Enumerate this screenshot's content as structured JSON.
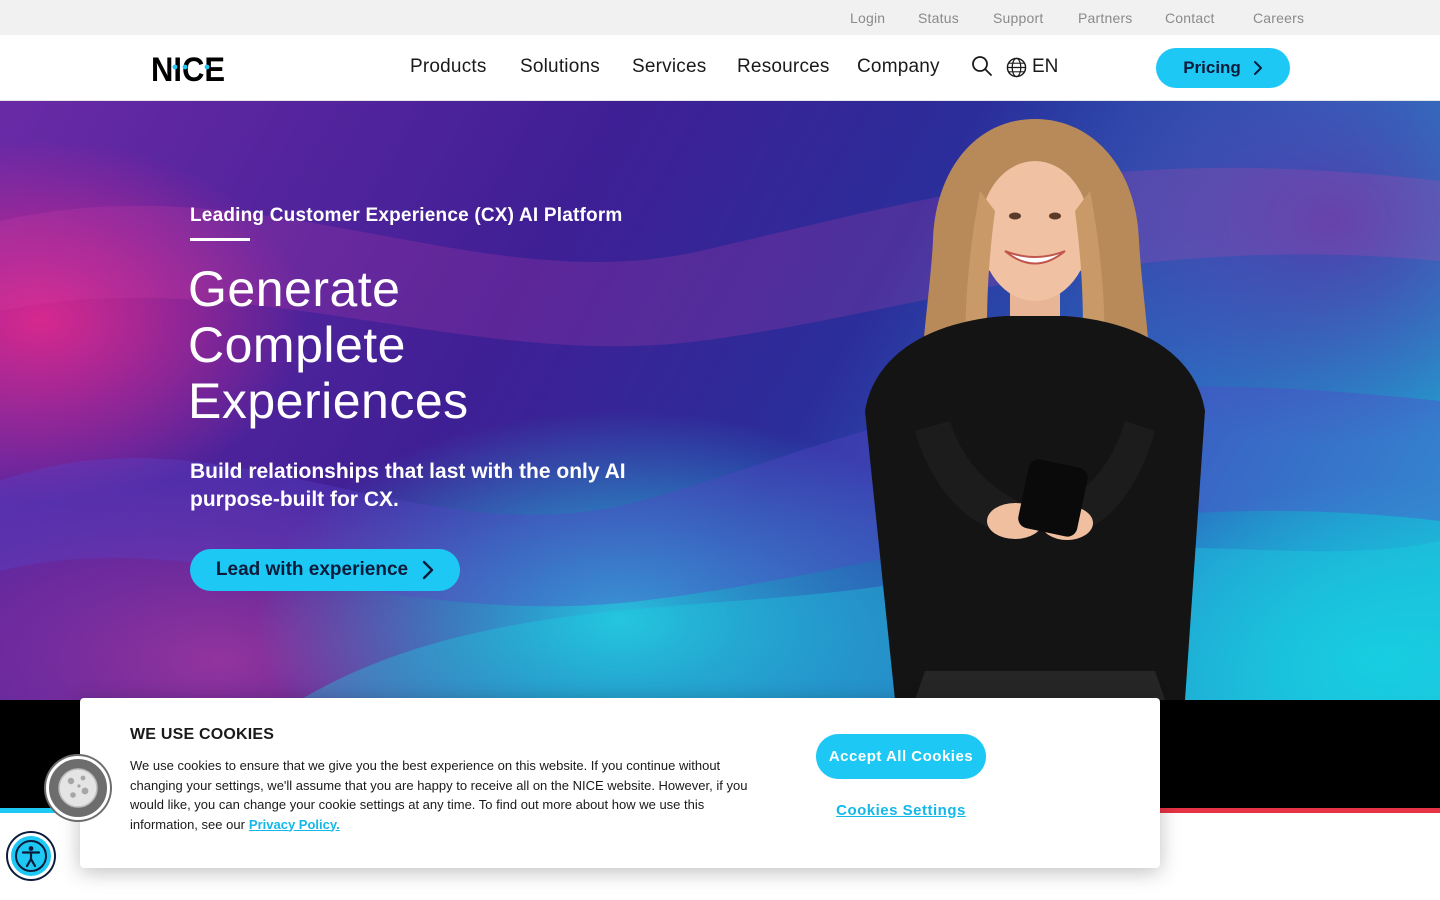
{
  "utility_nav": {
    "items": [
      "Login",
      "Status",
      "Support",
      "Partners",
      "Contact",
      "Careers"
    ]
  },
  "main_nav": {
    "logo_text": "NICE",
    "items": [
      "Products",
      "Solutions",
      "Services",
      "Resources",
      "Company"
    ],
    "language": "EN",
    "pricing_label": "Pricing"
  },
  "hero": {
    "eyebrow": "Leading Customer Experience (CX) AI Platform",
    "title_lines": [
      "Generate",
      "Complete",
      "Experiences"
    ],
    "subtitle": "Build relationships that last with the only AI purpose-built for CX.",
    "cta_label": "Lead with experience"
  },
  "cookie_banner": {
    "title": "WE USE COOKIES",
    "body": "We use cookies to ensure that we give you the best experience on this website. If you continue without changing your settings, we'll assume that you are happy to receive all on the NICE website. However, if you would like, you can change your cookie settings at any time. To find out more about how we use this information, see our",
    "privacy_link": "Privacy Policy.",
    "accept_label": "Accept All Cookies",
    "settings_label": "Cookies Settings"
  },
  "colors": {
    "accent": "#1ec8f5",
    "link": "#14b8e8",
    "stripe_red": "#e63345"
  },
  "icons": {
    "search": "search-icon",
    "language": "globe-icon",
    "chevron": "chevron-right-icon",
    "cookie_widget": "cookie-icon",
    "accessibility": "accessibility-icon"
  }
}
